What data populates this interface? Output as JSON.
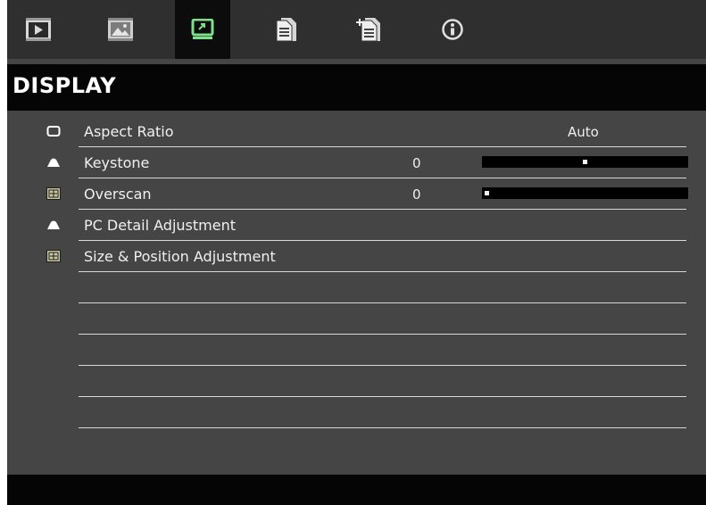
{
  "tabs": [
    {
      "name": "image-settings-tab",
      "icon": "monitor-play-icon",
      "active": false
    },
    {
      "name": "display-tab-1",
      "icon": "picture-film-icon",
      "active": false
    },
    {
      "name": "display-tab",
      "icon": "display-screen-icon",
      "active": true
    },
    {
      "name": "setup-tab",
      "icon": "document-icon",
      "active": false
    },
    {
      "name": "options-tab",
      "icon": "document-plus-icon",
      "active": false
    },
    {
      "name": "info-tab",
      "icon": "info-icon",
      "active": false
    }
  ],
  "page": {
    "title": "DISPLAY"
  },
  "rows": {
    "aspect_ratio": {
      "label": "Aspect Ratio",
      "value": "Auto",
      "icon": "rectangle-icon"
    },
    "keystone": {
      "label": "Keystone",
      "value": "0",
      "slider_fraction": 0.5,
      "icon": "trapezoid-icon"
    },
    "overscan": {
      "label": "Overscan",
      "value": "0",
      "slider_fraction": 0.0,
      "icon": "overscan-icon"
    },
    "pc_detail": {
      "label": "PC Detail Adjustment",
      "icon": "trapezoid-icon"
    },
    "size_position": {
      "label": "Size & Position Adjustment",
      "icon": "overscan-icon"
    }
  },
  "colors": {
    "active_tab_icon": "#7ee08a",
    "panel_background": "#454545",
    "bar_background": "#050505"
  }
}
